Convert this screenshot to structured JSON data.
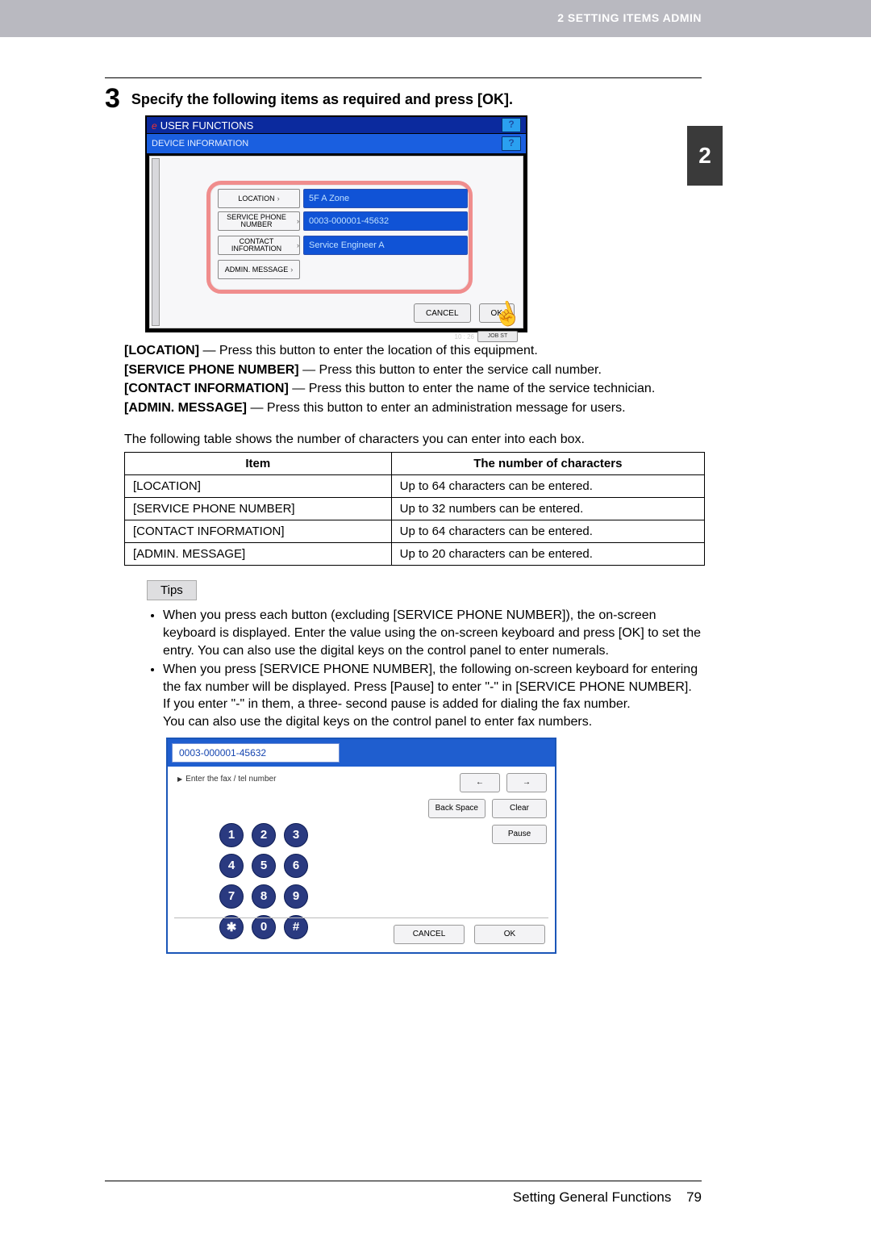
{
  "header": {
    "section": "2 SETTING ITEMS ADMIN",
    "chapter_tab": "2"
  },
  "step": {
    "number": "3",
    "title": "Specify the following items as required and press [OK]."
  },
  "device_panel": {
    "title": "USER FUNCTIONS",
    "subtitle": "DEVICE INFORMATION",
    "help": "?",
    "fields": {
      "location_btn": "LOCATION",
      "location_val": "5F A Zone",
      "phone_btn": "SERVICE PHONE NUMBER",
      "phone_val": "0003-000001-45632",
      "contact_btn": "CONTACT INFORMATION",
      "contact_val": "Service Engineer A",
      "admin_btn": "ADMIN. MESSAGE"
    },
    "cancel": "CANCEL",
    "ok": "OK",
    "clock": "10 : 26",
    "status_chip": "JOB ST"
  },
  "descriptions": {
    "loc": {
      "label": "[LOCATION]",
      "text": " — Press this button to enter the location of this equipment."
    },
    "phone": {
      "label": "[SERVICE PHONE NUMBER]",
      "text": " — Press this button to enter the service call number."
    },
    "contact": {
      "label": "[CONTACT INFORMATION]",
      "text": " — Press this button to enter the name of the service technician."
    },
    "admin": {
      "label": "[ADMIN. MESSAGE]",
      "text": " — Press this button to enter an administration message for users."
    }
  },
  "table_intro": "The following table shows the number of characters you can enter into each box.",
  "table": {
    "h1": "Item",
    "h2": "The number of characters",
    "r1c1": "[LOCATION]",
    "r1c2": "Up to 64 characters can be entered.",
    "r2c1": "[SERVICE PHONE NUMBER]",
    "r2c2": "Up to 32 numbers can be entered.",
    "r3c1": "[CONTACT INFORMATION]",
    "r3c2": "Up to 64 characters can be entered.",
    "r4c1": "[ADMIN. MESSAGE]",
    "r4c2": "Up to 20 characters can be entered."
  },
  "tips": {
    "label": "Tips",
    "t1": "When you press each button (excluding [SERVICE PHONE NUMBER]), the on-screen keyboard is displayed. Enter the value using the on-screen keyboard and press [OK] to set the entry. You can also use the digital keys on the control panel to enter numerals.",
    "t2": "When you press [SERVICE PHONE NUMBER], the following on-screen keyboard for entering the fax number will be displayed. Press [Pause] to enter \"-\" in [SERVICE PHONE NUMBER]. If you enter \"-\" in them, a three- second pause is added for dialing the fax number.",
    "t2b": "You can also use the digital keys on the control panel to enter fax numbers."
  },
  "keypad": {
    "input_value": "0003-000001-45632",
    "instruction": "Enter the fax / tel number",
    "left": "←",
    "right": "→",
    "backspace": "Back Space",
    "clear": "Clear",
    "pause": "Pause",
    "keys": {
      "k1": "1",
      "k2": "2",
      "k3": "3",
      "k4": "4",
      "k5": "5",
      "k6": "6",
      "k7": "7",
      "k8": "8",
      "k9": "9",
      "kstar": "✱",
      "k0": "0",
      "khash": "#"
    },
    "cancel": "CANCEL",
    "ok": "OK"
  },
  "footer": {
    "title": "Setting General Functions",
    "page": "79"
  }
}
